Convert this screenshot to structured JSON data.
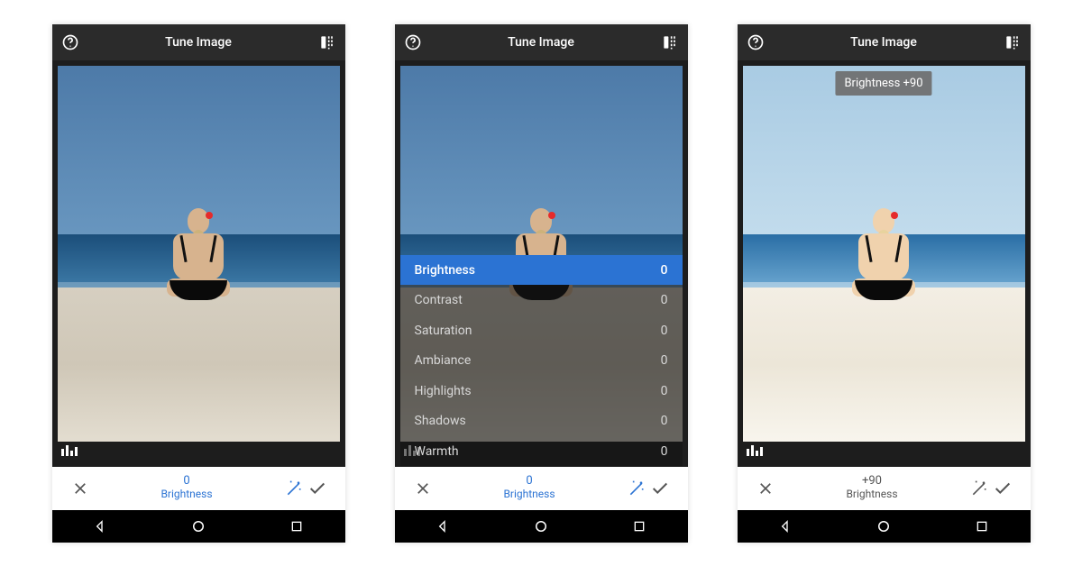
{
  "screens": [
    {
      "title": "Tune Image",
      "tone": "normal",
      "badge_visible": false,
      "badge_text": "",
      "params_visible": false,
      "action_value": "0",
      "action_label": "Brightness",
      "action_accent": true
    },
    {
      "title": "Tune Image",
      "tone": "normal",
      "badge_visible": false,
      "badge_text": "",
      "params_visible": true,
      "action_value": "0",
      "action_label": "Brightness",
      "action_accent": true
    },
    {
      "title": "Tune Image",
      "tone": "bright",
      "badge_visible": true,
      "badge_text": "Brightness +90",
      "params_visible": false,
      "action_value": "+90",
      "action_label": "Brightness",
      "action_accent": false
    }
  ],
  "params": [
    {
      "label": "Brightness",
      "value": "0",
      "selected": true
    },
    {
      "label": "Contrast",
      "value": "0",
      "selected": false
    },
    {
      "label": "Saturation",
      "value": "0",
      "selected": false
    },
    {
      "label": "Ambiance",
      "value": "0",
      "selected": false
    },
    {
      "label": "Highlights",
      "value": "0",
      "selected": false
    },
    {
      "label": "Shadows",
      "value": "0",
      "selected": false
    },
    {
      "label": "Warmth",
      "value": "0",
      "selected": false
    }
  ]
}
